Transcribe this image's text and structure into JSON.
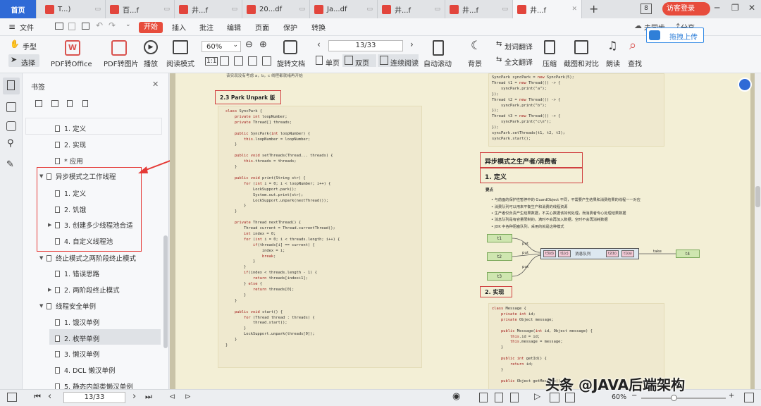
{
  "tabs": [
    {
      "label": "首页"
    },
    {
      "label": "T...)"
    },
    {
      "label": "百...f"
    },
    {
      "label": "井...f"
    },
    {
      "label": "20...df"
    },
    {
      "label": "Ja...df"
    },
    {
      "label": "井...f"
    },
    {
      "label": "井...f"
    },
    {
      "label": "井...f"
    }
  ],
  "tab_count": "8",
  "login_label": "访客登录",
  "menu": {
    "file": "文件",
    "start": "开始",
    "insert": "插入",
    "annotate": "批注",
    "edit": "编辑",
    "page": "页面",
    "protect": "保护",
    "convert": "转换",
    "sync": "未同步",
    "share": "分享"
  },
  "toolbar": {
    "hand": "手型",
    "select": "选择",
    "pdf_office": "PDF转Office",
    "pdf_image": "PDF转图片",
    "play": "播放",
    "read_mode": "阅读模式",
    "zoom": "60%",
    "rotate": "旋转文档",
    "page_value": "13/33",
    "single": "单页",
    "double": "双页",
    "continuous": "连续阅读",
    "auto_scroll": "自动滚动",
    "background": "背景",
    "translate_word": "划词翻译",
    "translate_full": "全文翻译",
    "compress": "压缩",
    "screenshot": "截图和对比",
    "read_aloud": "朗读",
    "find": "查找",
    "upload": "拖拽上传"
  },
  "panel": {
    "title": "书签",
    "items": [
      {
        "label": "1. 定义"
      },
      {
        "label": "2. 实现"
      },
      {
        "label": "* 应用"
      },
      {
        "label": "异步模式之工作线程"
      },
      {
        "label": "1. 定义"
      },
      {
        "label": "2. 饥饿"
      },
      {
        "label": "3. 创建多少线程池合适"
      },
      {
        "label": "4. 自定义线程池"
      },
      {
        "label": "终止模式之两阶段终止模式"
      },
      {
        "label": "1. 错误思路"
      },
      {
        "label": "2. 两阶段终止模式"
      },
      {
        "label": "线程安全单例"
      },
      {
        "label": "1. 饿汉单例"
      },
      {
        "label": "2. 枚举单例"
      },
      {
        "label": "3. 懒汉单例"
      },
      {
        "label": "4. DCL 懒汉单例"
      },
      {
        "label": "5. 静态内部类懒汉单例"
      }
    ]
  },
  "doc": {
    "top_note": "该实现没有考虑 a，b，c 线程都就绪再开始",
    "section_left": "2.3 Park Unpark 版",
    "code_left": [
      "class SyncPark {",
      "    private int loopNumber;",
      "    private Thread[] threads;",
      "",
      "    public SyncPark(int loopNumber) {",
      "        this.loopNumber = loopNumber;",
      "    }",
      "",
      "    public void setThreads(Thread... threads) {",
      "        this.threads = threads;",
      "    }",
      "",
      "    public void print(String str) {",
      "        for (int i = 0; i < loopNumber; i++) {",
      "            LockSupport.park();",
      "            System.out.print(str);",
      "            LockSupport.unpark(nextThread());",
      "        }",
      "    }",
      "",
      "    private Thread nextThread() {",
      "        Thread current = Thread.currentThread();",
      "        int index = 0;",
      "        for (int i = 0; i < threads.length; i++) {",
      "            if(threads[i] == current) {",
      "                index = i;",
      "                break;",
      "            }",
      "        }",
      "        if(index < threads.length - 1) {",
      "            return threads[index+1];",
      "        } else {",
      "            return threads[0];",
      "        }",
      "    }",
      "",
      "    public void start() {",
      "        for (Thread thread : threads) {",
      "            thread.start();",
      "        }",
      "        LockSupport.unpark(threads[0]);",
      "    }",
      "}"
    ],
    "code_right_top": [
      "SyncPark syncPark = new SyncPark(5);",
      "Thread t1 = new Thread(() -> {",
      "    syncPark.print(\"a\");",
      "});",
      "Thread t2 = new Thread(() -> {",
      "    syncPark.print(\"b\");",
      "});",
      "Thread t3 = new Thread(() -> {",
      "    syncPark.print(\"c\\n\");",
      "});",
      "syncPark.setThreads(t1, t2, t3);",
      "syncPark.start();"
    ],
    "section_right": "异步模式之生产者/消费者",
    "sub1": "1. 定义",
    "points_label": "要点",
    "bullets": [
      "与前面的保护性暂停中的 GuardObject 不同，不需要产生结果和消费结果的线程一一对应",
      "消费队列可以用来平衡生产和消费的线程资源",
      "生产者仅负责产生结果数据，不关心数据该如何处理，而消费者专心处理结果数据",
      "消息队列是有容量限制的，满时不会再加入数据，空时不会再消耗数据",
      "JDK 中各种阻塞队列，采用的就是这种模式"
    ],
    "diagram": {
      "t1": "t1",
      "t2": "t2",
      "t3": "t3",
      "put": "put",
      "take": "take",
      "queue": "消息队列",
      "items": [
        "t3(d)",
        "t1(c)",
        "t2(b)",
        "t1(a)"
      ],
      "t4": "t4"
    },
    "sub2": "2. 实现",
    "code_right_bottom": [
      "class Message {",
      "    private int id;",
      "    private Object message;",
      "",
      "    public Message(int id, Object message) {",
      "        this.id = id;",
      "        this.message = message;",
      "    }",
      "",
      "    public int getId() {",
      "        return id;",
      "    }",
      "",
      "    public Object getMessage() {"
    ]
  },
  "status": {
    "page": "13/33",
    "zoom": "60%"
  },
  "watermark": "头条 @JAVA后端架构"
}
